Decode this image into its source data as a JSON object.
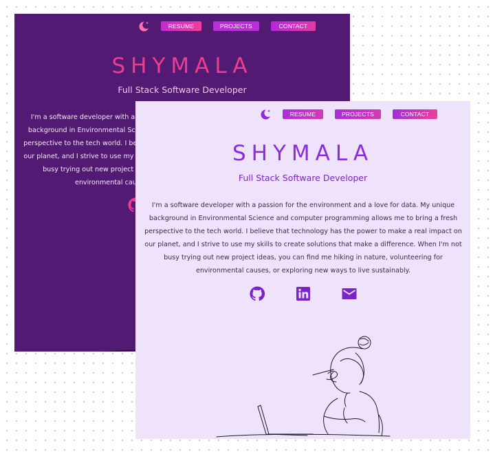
{
  "nav": {
    "resume_label": "RESUME",
    "projects_label": "PROJECTS",
    "contact_label": "CONTACT"
  },
  "hero": {
    "name": "SHYMALA",
    "subtitle": "Full Stack Software Developer",
    "bio": "I'm a software developer with a passion for the environment and a love for data. My unique background in Environmental Science and computer programming allows me to bring a fresh perspective to the tech world. I believe that technology has the power to make a real impact on our planet, and I strive to use my skills to create solutions that make a difference. When I'm not busy trying out new project ideas, you can find me hiking in nature, volunteering for environmental causes, or exploring new ways to live sustainably."
  },
  "socials": {
    "icons": [
      "github-icon",
      "linkedin-icon",
      "mail-icon"
    ]
  },
  "theme": {
    "dark_bg": "#521a73",
    "light_bg": "#efe3fb",
    "accent_pink": "#ee3d8d",
    "accent_purple": "#8a2be0"
  }
}
